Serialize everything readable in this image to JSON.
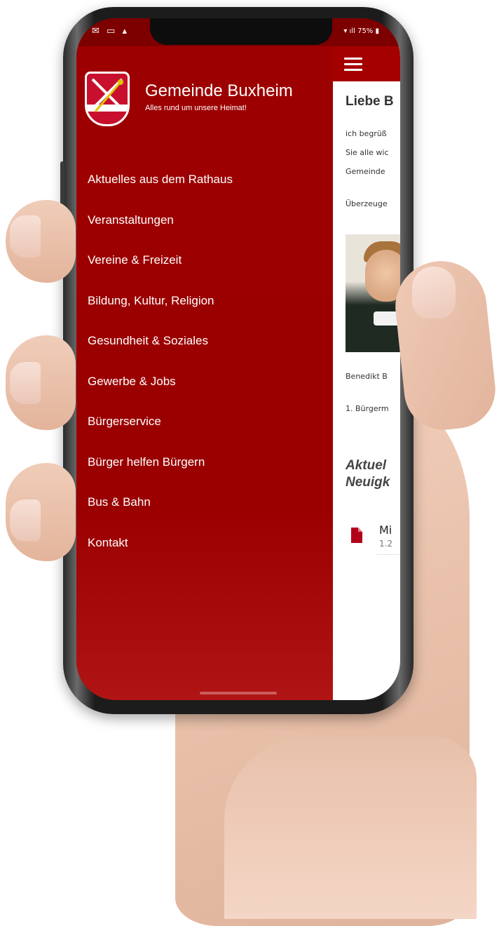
{
  "status_bar": {
    "left_icons": [
      "mail-icon",
      "chat-icon",
      "person-icon"
    ],
    "battery": "75%"
  },
  "brand": {
    "title": "Gemeinde Buxheim",
    "subtitle": "Alles rund um unsere Heimat!",
    "crest_color": "#c8102e"
  },
  "menu": [
    {
      "label": "Aktuelles aus dem Rathaus"
    },
    {
      "label": "Veranstaltungen"
    },
    {
      "label": "Vereine & Freizeit"
    },
    {
      "label": "Bildung, Kultur, Religion"
    },
    {
      "label": "Gesundheit & Soziales"
    },
    {
      "label": "Gewerbe & Jobs"
    },
    {
      "label": "Bürgerservice"
    },
    {
      "label": "Bürger helfen Bürgern"
    },
    {
      "label": "Bus & Bahn"
    },
    {
      "label": "Kontakt"
    }
  ],
  "content": {
    "heading": "Liebe B",
    "lines": [
      "ich begrüß",
      "Sie alle wic",
      "Gemeinde",
      "Überzeuge"
    ],
    "caption_name": "Benedikt B",
    "caption_role": "1. Bürgerm",
    "news_heading_line1": "Aktuel",
    "news_heading_line2": "Neuigk",
    "doc_title": "Mi",
    "doc_size": "1.2"
  },
  "colors": {
    "drawer": "#9d0000",
    "topbar": "#a50000",
    "doc_icon": "#b0001a"
  }
}
